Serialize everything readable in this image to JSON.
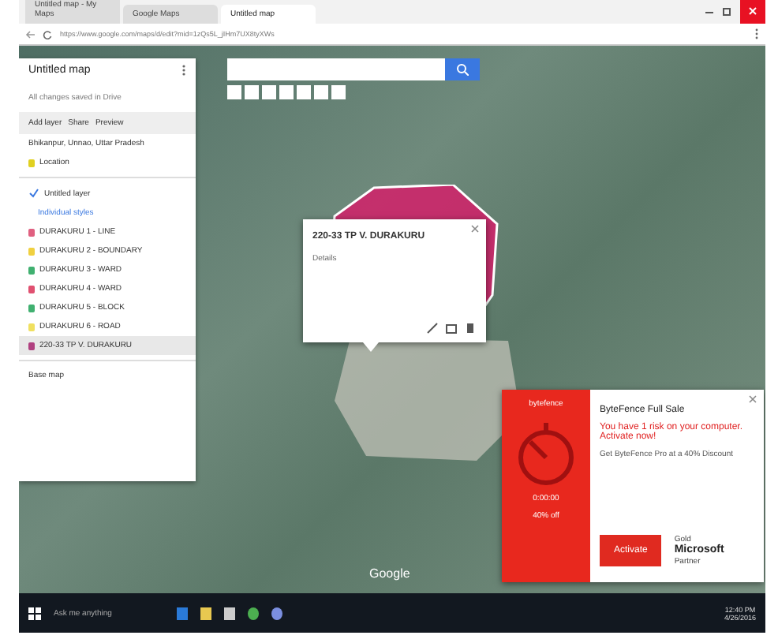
{
  "browser": {
    "tabs": [
      {
        "label": "Untitled map - My Maps",
        "selected": false
      },
      {
        "label": "Google Maps",
        "selected": false
      },
      {
        "label": "Untitled map",
        "selected": true
      }
    ],
    "url": "https://www.google.com/maps/d/edit?mid=1zQs5L_jIHm7UX8tyXWs"
  },
  "sidebar": {
    "title": "Untitled map",
    "subtitle": "All changes saved in Drive",
    "actions": [
      "Add layer",
      "Share",
      "Preview"
    ],
    "search_layer": "Bhikanpur, Unnao, Uttar Pradesh",
    "search_result": "Location",
    "layer_title": "Untitled layer",
    "layer_style": "Individual styles",
    "items": [
      {
        "label": "DURAKURU 1 - LINE",
        "color": "#e06080",
        "selected": false
      },
      {
        "label": "DURAKURU 2 - BOUNDARY",
        "color": "#f0d040",
        "selected": false
      },
      {
        "label": "DURAKURU 3 - WARD",
        "color": "#40b070",
        "selected": false
      },
      {
        "label": "DURAKURU 4 - WARD",
        "color": "#e05070",
        "selected": false
      },
      {
        "label": "DURAKURU 5 - BLOCK",
        "color": "#40b070",
        "selected": false
      },
      {
        "label": "DURAKURU 6 - ROAD",
        "color": "#f0e060",
        "selected": false
      },
      {
        "label": "220-33 TP V. DURAKURU",
        "color": "#b04080",
        "selected": true
      }
    ],
    "base_map": "Base map"
  },
  "info_card": {
    "title": "220-33 TP V. DURAKURU",
    "description": "Details"
  },
  "map": {
    "attribution": "Google"
  },
  "ad": {
    "brand": "bytefence",
    "title": "ByteFence Full Sale",
    "message": "You have 1 risk on your computer. Activate now!",
    "offer": "Get ByteFence Pro at a 40% Discount",
    "timer": "0:00:00",
    "discount": "40% off",
    "button": "Activate",
    "partner_top": "Gold",
    "partner": "Microsoft",
    "partner_bottom": "Partner"
  },
  "taskbar": {
    "search_placeholder": "Ask me anything",
    "time": "12:40 PM",
    "date": "4/26/2016"
  }
}
